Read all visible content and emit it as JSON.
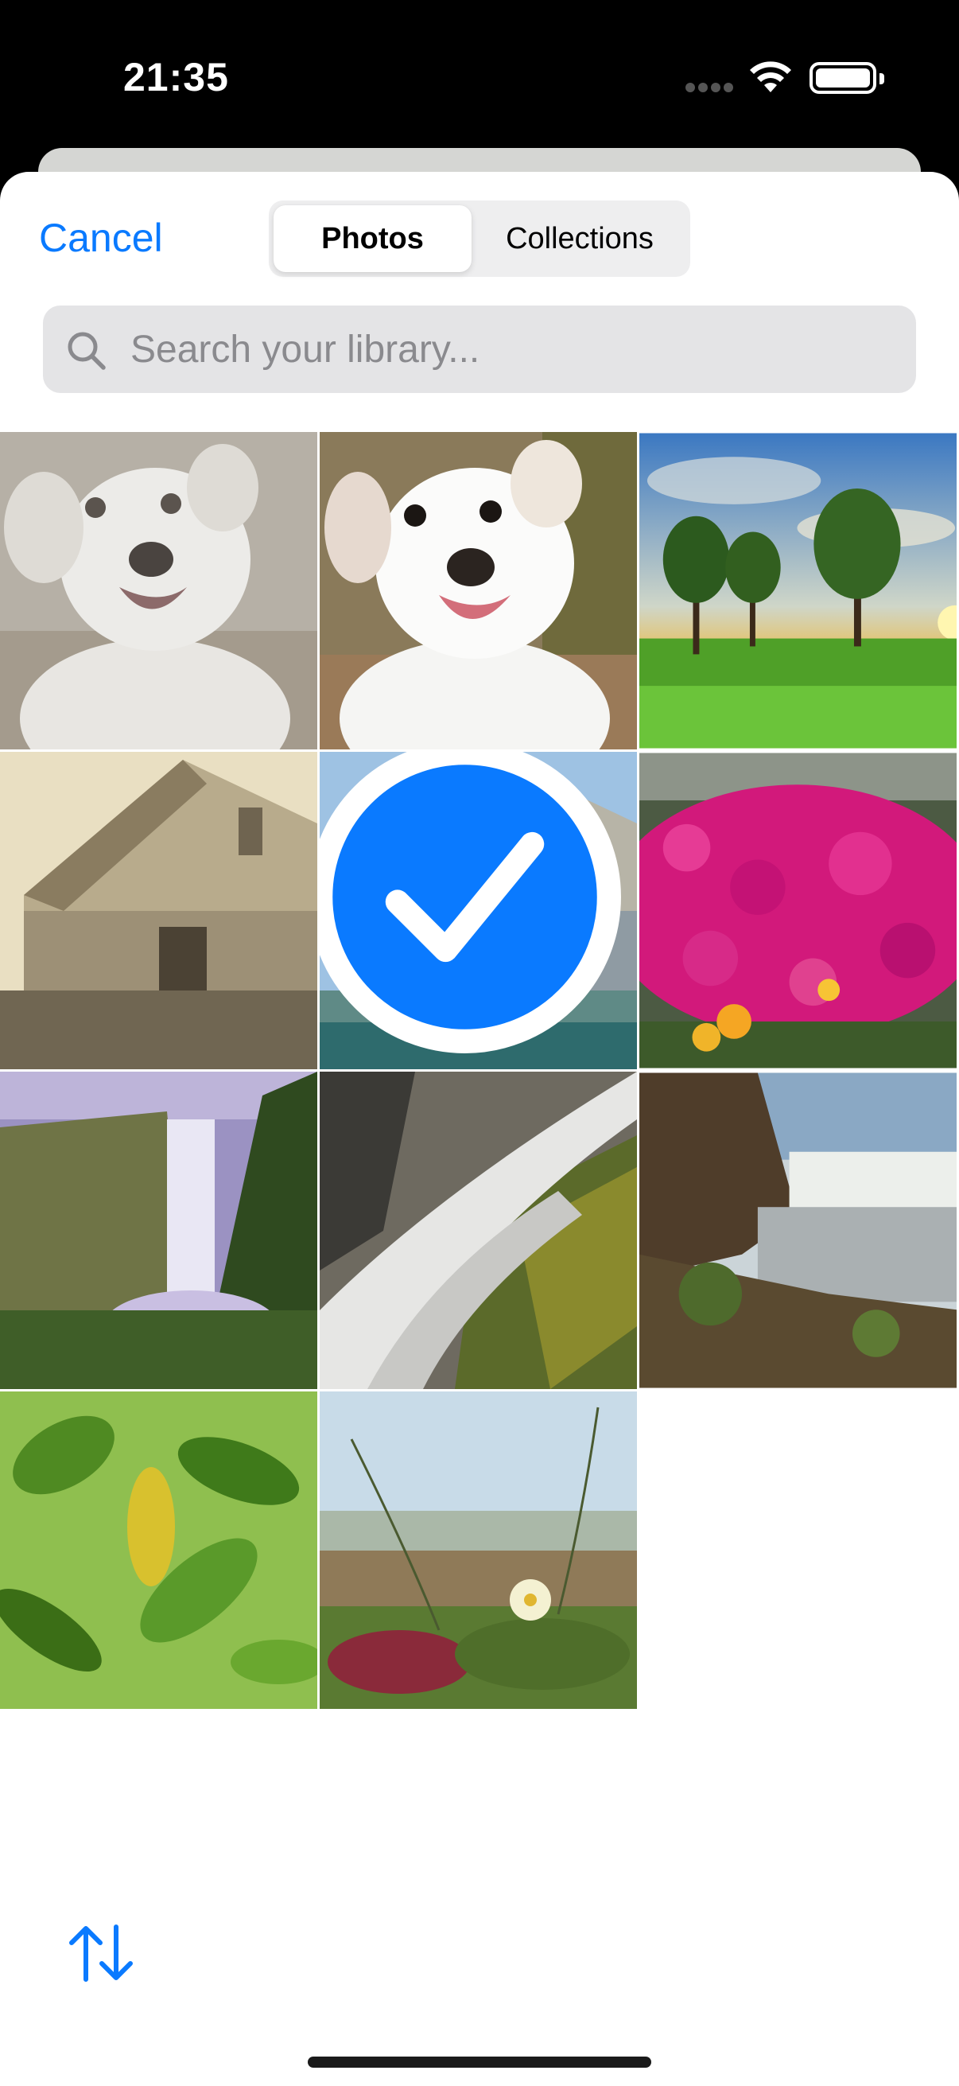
{
  "status_bar": {
    "time": "21:35"
  },
  "header": {
    "cancel_label": "Cancel",
    "tabs": [
      {
        "label": "Photos",
        "selected": true
      },
      {
        "label": "Collections",
        "selected": false
      }
    ]
  },
  "search": {
    "placeholder": "Search your library..."
  },
  "grid": {
    "photos": [
      {
        "subject": "puppy (faded)",
        "selected": false
      },
      {
        "subject": "puppy",
        "selected": false
      },
      {
        "subject": "trees at sunset",
        "selected": false
      },
      {
        "subject": "barn (sepia)",
        "selected": false
      },
      {
        "subject": "barn (blurred color)",
        "selected": true
      },
      {
        "subject": "pink flowers",
        "selected": false
      },
      {
        "subject": "waterfall (misty)",
        "selected": false
      },
      {
        "subject": "waterfall closeup",
        "selected": false
      },
      {
        "subject": "waterfall river",
        "selected": false
      },
      {
        "subject": "leaves",
        "selected": false
      },
      {
        "subject": "beach flower",
        "selected": false
      }
    ]
  },
  "colors": {
    "accent": "#0a7aff",
    "sheet_bg": "#ffffff",
    "search_bg": "#e4e4e6"
  },
  "icons": {
    "search": "magnifying-glass",
    "sort": "arrow-up-arrow-down",
    "check": "checkmark-circle"
  }
}
